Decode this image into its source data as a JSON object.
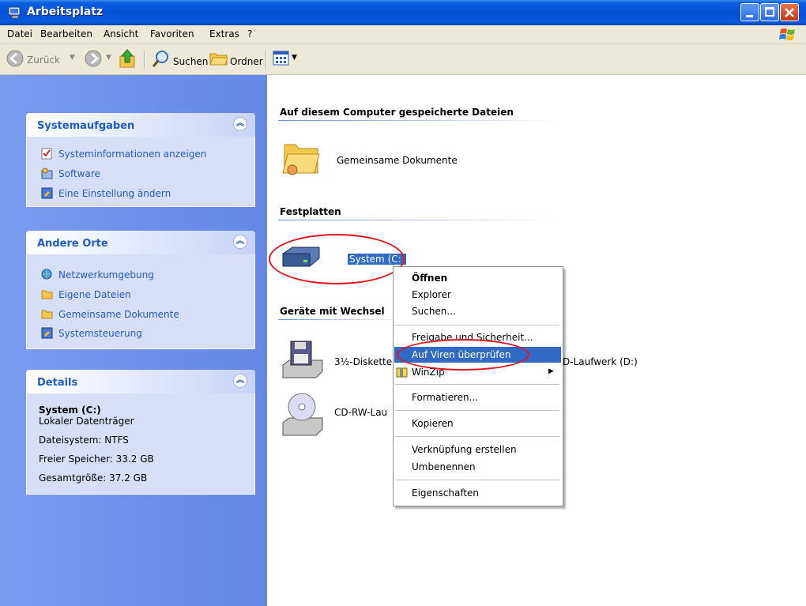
{
  "window": {
    "title": "Arbeitsplatz"
  },
  "menubar": {
    "items": [
      "Datei",
      "Bearbeiten",
      "Ansicht",
      "Favoriten",
      "Extras",
      "?"
    ]
  },
  "toolbar": {
    "back_label": "Zurück",
    "search_label": "Suchen",
    "folders_label": "Ordner"
  },
  "sidebar": {
    "system_tasks": {
      "title": "Systemaufgaben",
      "links": [
        "Systeminformationen anzeigen",
        "Software",
        "Eine Einstellung ändern"
      ]
    },
    "other_places": {
      "title": "Andere Orte",
      "links": [
        "Netzwerkumgebung",
        "Eigene Dateien",
        "Gemeinsame Dokumente",
        "Systemsteuerung"
      ]
    },
    "details": {
      "title": "Details",
      "name": "System (C:)",
      "type": "Lokaler Datenträger",
      "filesystem": "Dateisystem: NTFS",
      "free": "Freier Speicher: 33.2 GB",
      "total": "Gesamtgröße: 37.2 GB"
    }
  },
  "content": {
    "group_files": "Auf diesem Computer gespeicherte Dateien",
    "shared_docs": "Gemeinsame Dokumente",
    "group_disks": "Festplatten",
    "drive_c": "System (C:)",
    "group_removable": "Geräte mit Wechsel",
    "floppy": "3½-Diskette",
    "dvd": "D-Laufwerk (D:)",
    "cdrw": "CD-RW-Lau"
  },
  "context_menu": {
    "items": [
      "Öffnen",
      "Explorer",
      "Suchen...",
      "Freigabe und Sicherheit...",
      "Auf Viren überprüfen",
      "WinZip",
      "Formatieren...",
      "Kopieren",
      "Verknüpfung erstellen",
      "Umbenennen",
      "Eigenschaften"
    ],
    "highlighted": "Auf Viren überprüfen"
  },
  "colors": {
    "title_bar": "#0551d6",
    "task_pane": "#7a9bee",
    "link": "#215dc6",
    "highlight": "#316ac5",
    "annotation": "#e0151d"
  }
}
